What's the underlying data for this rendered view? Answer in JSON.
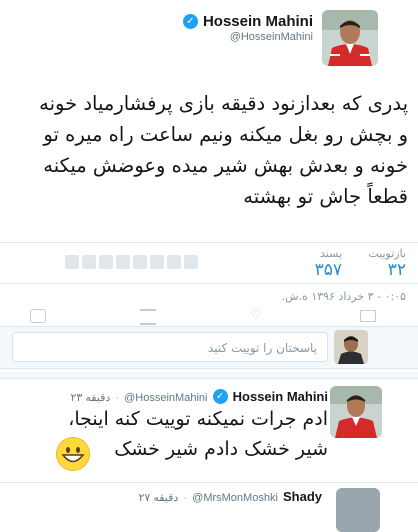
{
  "main_tweet": {
    "name": "Hossein Mahini",
    "handle": "@HosseinMahini",
    "text_lines": [
      "پدری که بعدازنود دقیقه بازی پرفشارمیاد خونه",
      "و بچش رو بغل میکنه ونیم ساعت راه میره تو",
      "خونه و بعدش بهش شیر میده وعوضش میکنه",
      "قطعاً جاش تو بهشته"
    ],
    "stats": {
      "retweets_label": "بازتوییت",
      "retweets_value": "۳۲",
      "likes_label": "پسند",
      "likes_value": "۳۵۷"
    },
    "timestamp": "۰:۰۵ - ۳ خرداد ۱۳۹۶ ه.ش."
  },
  "reply_box": {
    "placeholder": "پاسختان را توییت کنید"
  },
  "reply_tweet": {
    "name": "Hossein Mahini",
    "handle": "@HosseinMahini",
    "time": "۲۳ دقیقه",
    "text_lines": [
      "ادم جرات نمیکنه توییت کنه اینجا،",
      "شیر خشک دادم شیر خشک"
    ],
    "emoji": "grinning-face"
  },
  "next_tweet": {
    "name": "Shady",
    "handle": "@MrsMonMoshki",
    "time": "۲۷ دقیقه"
  },
  "colors": {
    "accent": "#2a8cc9",
    "verified": "#1da1f2",
    "separator": "#e1e8ed",
    "muted": "#8899a6"
  }
}
